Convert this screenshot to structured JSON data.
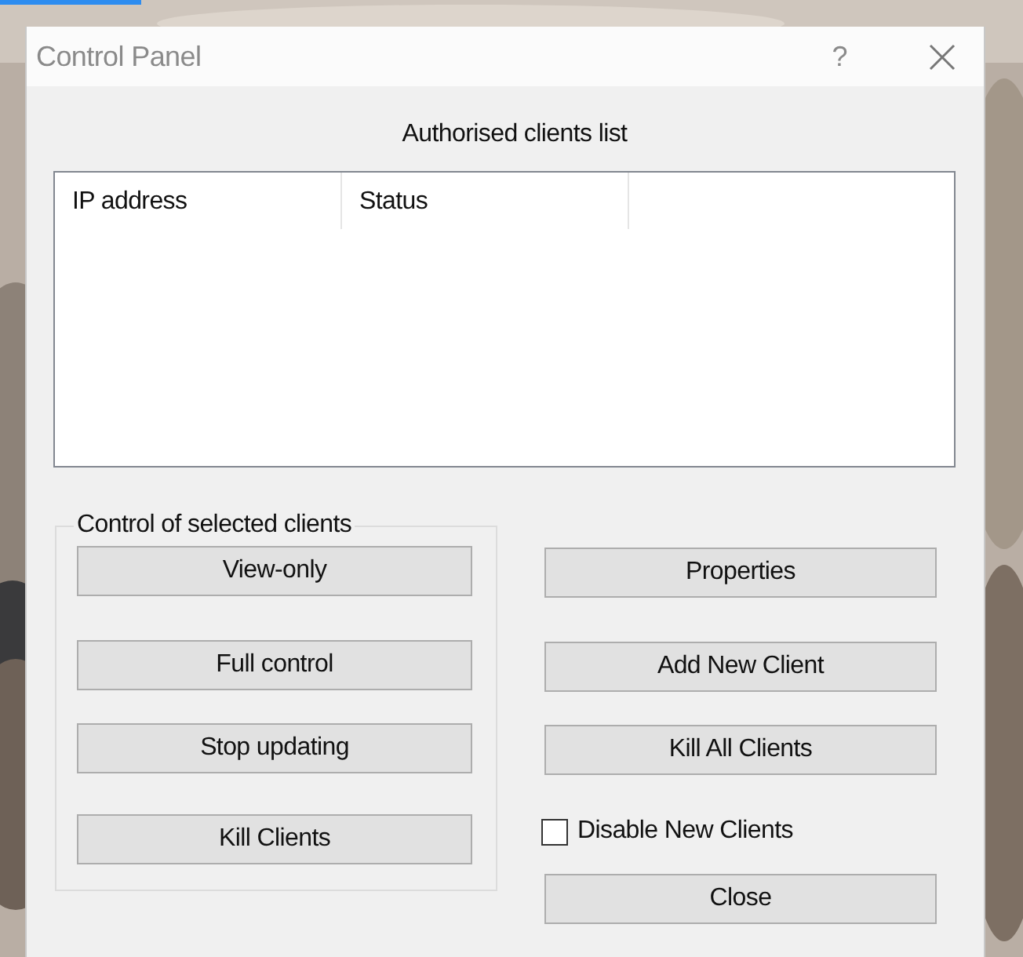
{
  "window": {
    "title": "Control Panel",
    "help": "?"
  },
  "list_label": "Authorised clients list",
  "clients_table": {
    "columns": [
      "IP address",
      "Status"
    ]
  },
  "group": {
    "title": "Control of selected clients",
    "buttons": [
      "View-only",
      "Full control",
      "Stop updating",
      "Kill Clients"
    ]
  },
  "side_buttons": [
    "Properties",
    "Add New Client",
    "Kill All Clients"
  ],
  "checkbox": {
    "label": "Disable New Clients",
    "checked": false
  },
  "close_button": "Close"
}
